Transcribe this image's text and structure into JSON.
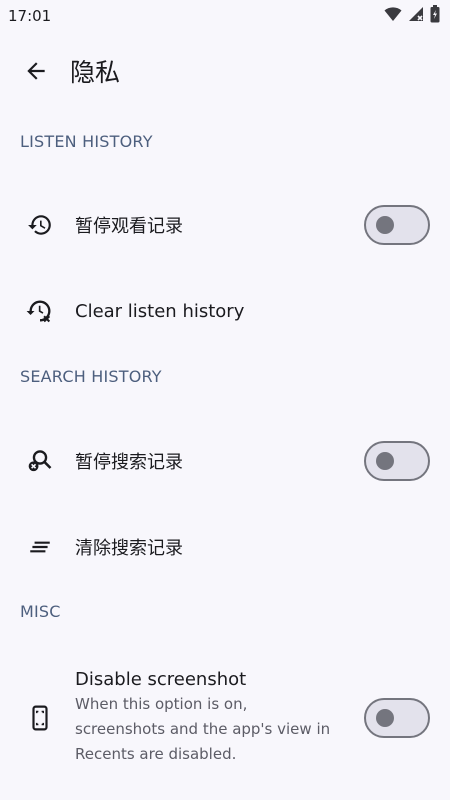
{
  "status_bar": {
    "time": "17:01",
    "icons": [
      "wifi-icon",
      "signal-icon",
      "battery-icon"
    ]
  },
  "app_bar": {
    "title": "隐私",
    "back_icon": "arrow-back-icon"
  },
  "sections": {
    "listen_history": {
      "header": "LISTEN HISTORY",
      "pause_label": "暂停观看记录",
      "pause_on": false,
      "clear_label": "Clear listen history"
    },
    "search_history": {
      "header": "SEARCH HISTORY",
      "pause_label": "暂停搜索记录",
      "pause_on": false,
      "clear_label": "清除搜索记录"
    },
    "misc": {
      "header": "MISC",
      "screenshot_title": "Disable screenshot",
      "screenshot_sub_1": "When this option is on,",
      "screenshot_sub_2": "screenshots and the app's view in",
      "screenshot_sub_3": "Recents are disabled.",
      "screenshot_on": false
    }
  },
  "colors": {
    "background": "#f8f7fc",
    "section_header": "#4d5f7e",
    "switch_outline": "#74757e",
    "switch_track": "#e3e2ec"
  }
}
